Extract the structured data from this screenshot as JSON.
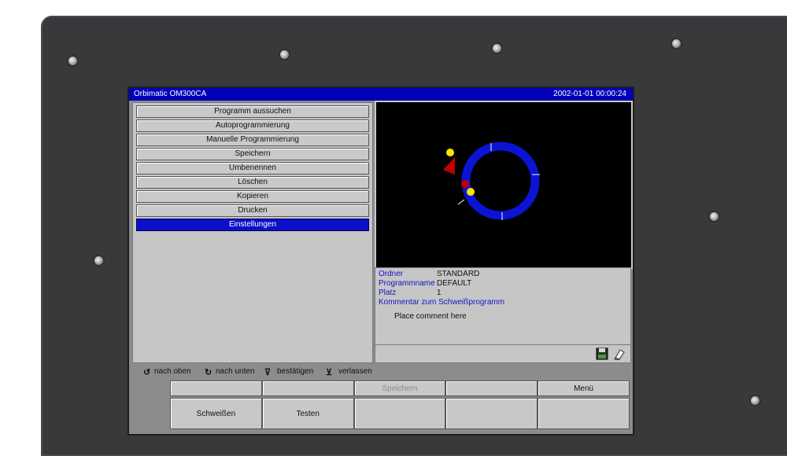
{
  "window": {
    "title": "Orbimatic OM300CA",
    "clock": "2002-01-01 00:00:24"
  },
  "menu": {
    "items": [
      "Programm aussuchen",
      "Autoprogrammierung",
      "Manuelle Programmierung",
      "Speichern",
      "Umbenennen",
      "Löschen",
      "Kopieren",
      "Drucken",
      "Einstellungen"
    ],
    "selected": "Einstellungen"
  },
  "info": {
    "ordner_label": "Ordner",
    "ordner_value": "STANDARD",
    "programmname_label": "Programmname",
    "programmname_value": "DEFAULT",
    "platz_label": "Platz",
    "platz_value": "1",
    "kommentar_label": "Kommentar zum Schweißprogramm",
    "comment_placeholder": "Place comment here"
  },
  "hints": {
    "up": "nach oben",
    "down": "nach unten",
    "confirm": "bestätigen",
    "leave": "verlassen"
  },
  "fkeys_top": [
    "Speichern",
    "",
    "Menü"
  ],
  "fkeys_bottom": [
    "Schweißen",
    "Testen",
    "",
    "",
    ""
  ],
  "colors": {
    "title_bar": "#0000b8",
    "selection": "#0a10c8",
    "ring": "#0a14d2",
    "marker_yellow": "#ffe600",
    "marker_red": "#c00000"
  },
  "icons": [
    "floppy-disk-icon",
    "eraser-icon"
  ]
}
